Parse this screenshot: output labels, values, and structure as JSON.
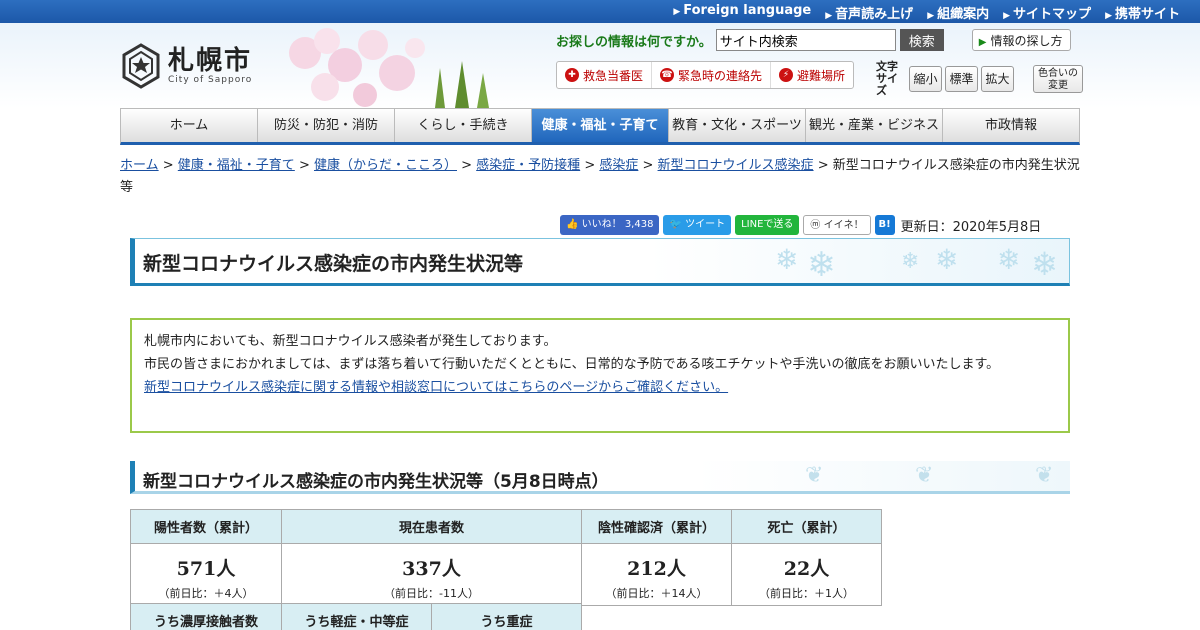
{
  "topbar": {
    "links": [
      "Foreign language",
      "音声読み上げ",
      "組織案内",
      "サイトマップ",
      "携帯サイト"
    ]
  },
  "logo": {
    "name": "札幌市",
    "sub": "City of Sapporo"
  },
  "search": {
    "question": "お探しの情報は何ですか。",
    "value": "サイト内検索",
    "button": "検索",
    "howto": "情報の探し方"
  },
  "emergency": [
    {
      "icon": "hospital-icon",
      "label": "救急当番医"
    },
    {
      "icon": "phone-icon",
      "label": "緊急時の連絡先"
    },
    {
      "icon": "evacuation-icon",
      "label": "避難場所"
    }
  ],
  "fontsize": {
    "label": "文字サイズ",
    "small": "縮小",
    "normal": "標準",
    "large": "拡大",
    "color": "色合いの変更"
  },
  "nav": [
    "ホーム",
    "防災・防犯・消防",
    "くらし・手続き",
    "健康・福祉・子育て",
    "教育・文化・スポーツ",
    "観光・産業・ビジネス",
    "市政情報"
  ],
  "nav_active": 3,
  "breadcrumb": {
    "links": [
      "ホーム",
      "健康・福祉・子育て",
      "健康（からだ・こころ）",
      "感染症・予防接種",
      "感染症",
      "新型コロナウイルス感染症"
    ],
    "current": "新型コロナウイルス感染症の市内発生状況等"
  },
  "social": {
    "like": "いいね！ 3,438",
    "tweet": "ツイート",
    "line": "LINEで送る",
    "mixi": "イイネ！",
    "hatena": "B!",
    "updated": "更新日：2020年5月8日"
  },
  "title": "新型コロナウイルス感染症の市内発生状況等",
  "notice": {
    "line1": "札幌市内においても、新型コロナウイルス感染者が発生しております。",
    "line2": "市民の皆さまにおかれましては、まずは落ち着いて行動いただくとともに、日常的な予防である咳エチケットや手洗いの徹底をお願いいたします。",
    "link": "新型コロナウイルス感染症に関する情報や相談窓口についてはこちらのページからご確認ください。"
  },
  "section_title": "新型コロナウイルス感染症の市内発生状況等（5月8日時点）",
  "table": {
    "headers": [
      "陽性者数（累計）",
      "現在患者数",
      "陰性確認済（累計）",
      "死亡（累計）"
    ],
    "values": [
      {
        "v": "571人",
        "d": "（前日比：＋4人）"
      },
      {
        "v": "337人",
        "d": "（前日比：-11人）"
      },
      {
        "v": "212人",
        "d": "（前日比：＋14人）"
      },
      {
        "v": "22人",
        "d": "（前日比：＋1人）"
      }
    ],
    "sub_headers": [
      "うち濃厚接触者数",
      "うち軽症・中等症",
      "うち重症"
    ]
  }
}
